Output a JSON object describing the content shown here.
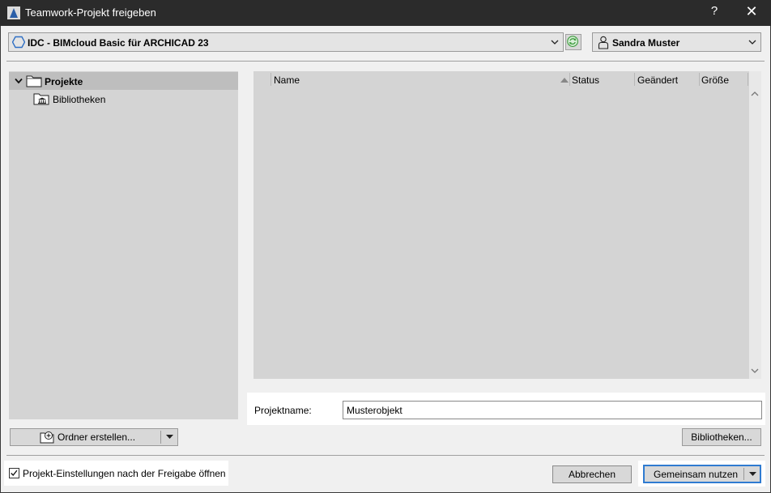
{
  "window": {
    "title": "Teamwork-Projekt freigeben",
    "help_label": "?",
    "close_label": "✕"
  },
  "server": {
    "selected": "IDC - BIMcloud Basic für ARCHICAD 23"
  },
  "user": {
    "selected": "Sandra Muster"
  },
  "tree": {
    "items": [
      {
        "label": "Projekte",
        "expanded": true,
        "selected": true
      },
      {
        "label": "Bibliotheken",
        "expanded": false,
        "selected": false
      }
    ]
  },
  "filelist": {
    "columns": [
      "Name",
      "Status",
      "Geändert",
      "Größe"
    ],
    "sorted_by": "Name",
    "rows": []
  },
  "project_name": {
    "label": "Projektname:",
    "value": "Musterobjekt"
  },
  "buttons": {
    "create_folder": "Ordner erstellen...",
    "libraries": "Bibliotheken...",
    "cancel": "Abbrechen",
    "share": "Gemeinsam nutzen"
  },
  "options": {
    "open_settings_label": "Projekt-Einstellungen nach der Freigabe öffnen",
    "open_settings_checked": true
  },
  "colors": {
    "titlebar": "#2b2b2b",
    "panel": "#d4d4d4",
    "selection": "#bebebe",
    "accent": "#2f7bd1",
    "sync_green": "#3a9a3a"
  }
}
